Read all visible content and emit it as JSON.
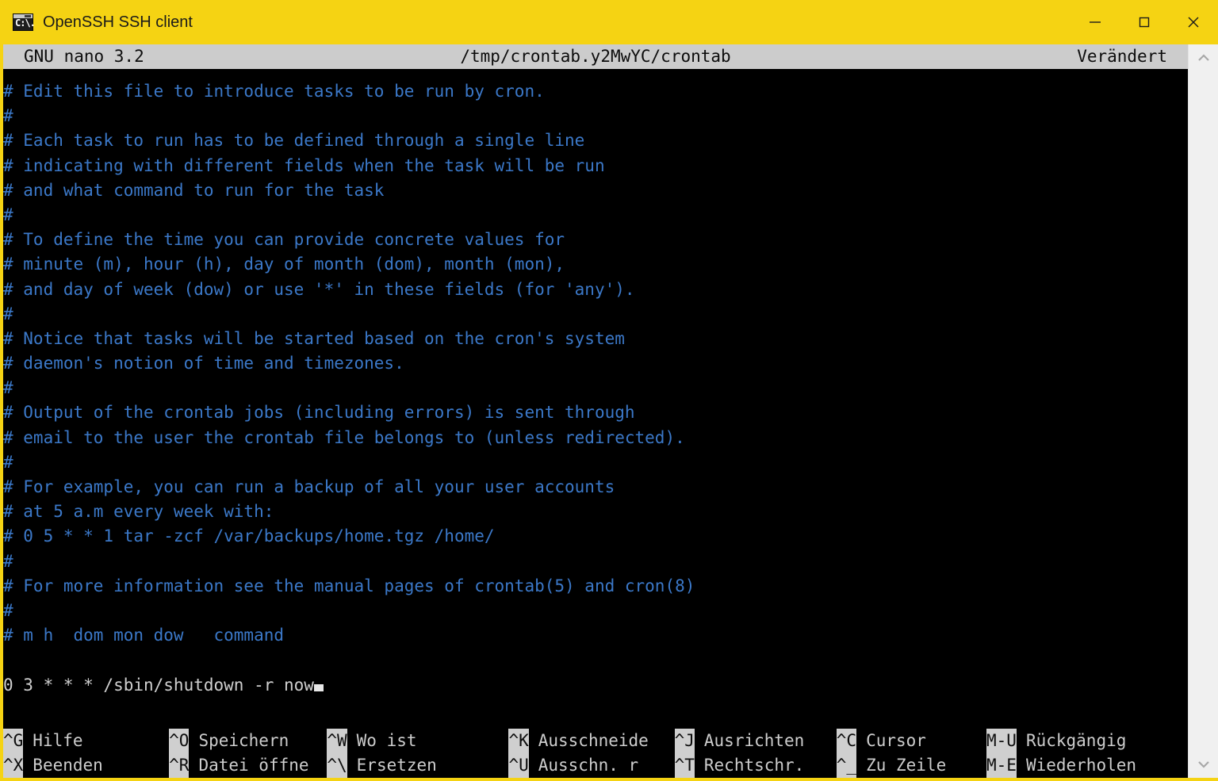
{
  "window": {
    "title": "OpenSSH SSH client",
    "icon": "console-icon",
    "icon_prompt": "C:\\.",
    "titlebar_color": "#f5d313",
    "controls": {
      "minimize_label": "minimize-icon",
      "maximize_label": "maximize-icon",
      "close_label": "close-icon"
    }
  },
  "nano": {
    "version": "GNU nano 3.2",
    "filename": "/tmp/crontab.y2MwYC/crontab",
    "status": "Verändert",
    "header_bg": "#cccccc",
    "comment_color": "#3b78c8",
    "text_color": "#cfcfcf",
    "background": "#000000"
  },
  "editor": {
    "lines": [
      {
        "text": "# Edit this file to introduce tasks to be run by cron.",
        "type": "comment"
      },
      {
        "text": "#",
        "type": "comment"
      },
      {
        "text": "# Each task to run has to be defined through a single line",
        "type": "comment"
      },
      {
        "text": "# indicating with different fields when the task will be run",
        "type": "comment"
      },
      {
        "text": "# and what command to run for the task",
        "type": "comment"
      },
      {
        "text": "#",
        "type": "comment"
      },
      {
        "text": "# To define the time you can provide concrete values for",
        "type": "comment"
      },
      {
        "text": "# minute (m), hour (h), day of month (dom), month (mon),",
        "type": "comment"
      },
      {
        "text": "# and day of week (dow) or use '*' in these fields (for 'any').",
        "type": "comment"
      },
      {
        "text": "#",
        "type": "comment"
      },
      {
        "text": "# Notice that tasks will be started based on the cron's system",
        "type": "comment"
      },
      {
        "text": "# daemon's notion of time and timezones.",
        "type": "comment"
      },
      {
        "text": "#",
        "type": "comment"
      },
      {
        "text": "# Output of the crontab jobs (including errors) is sent through",
        "type": "comment"
      },
      {
        "text": "# email to the user the crontab file belongs to (unless redirected).",
        "type": "comment"
      },
      {
        "text": "#",
        "type": "comment"
      },
      {
        "text": "# For example, you can run a backup of all your user accounts",
        "type": "comment"
      },
      {
        "text": "# at 5 a.m every week with:",
        "type": "comment"
      },
      {
        "text": "# 0 5 * * 1 tar -zcf /var/backups/home.tgz /home/",
        "type": "comment"
      },
      {
        "text": "#",
        "type": "comment"
      },
      {
        "text": "# For more information see the manual pages of crontab(5) and cron(8)",
        "type": "comment"
      },
      {
        "text": "#",
        "type": "comment"
      },
      {
        "text": "# m h  dom mon dow   command",
        "type": "comment"
      },
      {
        "text": "",
        "type": "comment"
      },
      {
        "text": "0 3 * * * /sbin/shutdown -r now",
        "type": "code",
        "cursor": true
      }
    ]
  },
  "shortcuts": {
    "row1": [
      {
        "key": "^G",
        "label": "Hilfe"
      },
      {
        "key": "^O",
        "label": "Speichern"
      },
      {
        "key": "^W",
        "label": "Wo ist"
      },
      {
        "key": "^K",
        "label": "Ausschneide"
      },
      {
        "key": "^J",
        "label": "Ausrichten"
      },
      {
        "key": "^C",
        "label": "Cursor"
      },
      {
        "key": "M-U",
        "label": "Rückgängig"
      }
    ],
    "row2": [
      {
        "key": "^X",
        "label": "Beenden"
      },
      {
        "key": "^R",
        "label": "Datei öffne"
      },
      {
        "key": "^\\",
        "label": "Ersetzen"
      },
      {
        "key": "^U",
        "label": "Ausschn. r"
      },
      {
        "key": "^T",
        "label": "Rechtschr."
      },
      {
        "key": "^_",
        "label": "Zu Zeile"
      },
      {
        "key": "M-E",
        "label": "Wiederholen"
      }
    ]
  },
  "scrollbar": {
    "up_arrow": "chevron-up-icon",
    "down_arrow": "chevron-down-icon"
  }
}
